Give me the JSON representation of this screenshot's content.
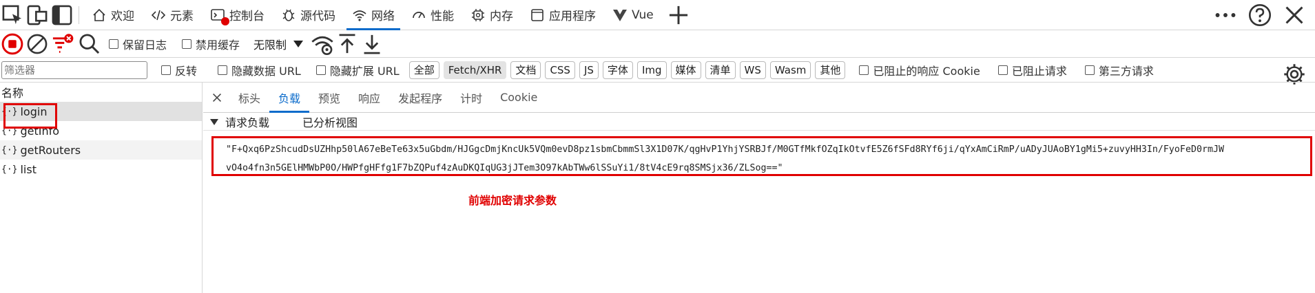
{
  "colors": {
    "accent": "#0b6bcb",
    "highlight": "#e00000",
    "record": "#e00000"
  },
  "tabs": [
    {
      "label": "欢迎",
      "icon": "home-icon"
    },
    {
      "label": "元素",
      "icon": "code-icon"
    },
    {
      "label": "控制台",
      "icon": "console-icon"
    },
    {
      "label": "源代码",
      "icon": "bug-icon"
    },
    {
      "label": "网络",
      "icon": "wifi-icon",
      "active": true
    },
    {
      "label": "性能",
      "icon": "gauge-icon"
    },
    {
      "label": "内存",
      "icon": "memory-chip-icon"
    },
    {
      "label": "应用程序",
      "icon": "application-icon"
    },
    {
      "label": "Vue",
      "icon": "vue-logo-icon"
    }
  ],
  "toolbar": {
    "preserve_log": "保留日志",
    "disable_cache": "禁用缓存",
    "throttle": "无限制"
  },
  "filterbar": {
    "filter_placeholder": "筛选器",
    "invert": "反转",
    "hide_data_url": "隐藏数据 URL",
    "hide_ext_url": "隐藏扩展 URL",
    "types": [
      "全部",
      "Fetch/XHR",
      "文档",
      "CSS",
      "JS",
      "字体",
      "Img",
      "媒体",
      "清单",
      "WS",
      "Wasm",
      "其他"
    ],
    "blocked_cookie": "已阻止的响应 Cookie",
    "blocked_requests": "已阻止请求",
    "third_party": "第三方请求"
  },
  "left": {
    "header": "名称",
    "requests": [
      "login",
      "getInfo",
      "getRouters",
      "list"
    ]
  },
  "detail": {
    "subtabs": [
      "标头",
      "负载",
      "预览",
      "响应",
      "发起程序",
      "计时",
      "Cookie"
    ],
    "section_title": "请求负载",
    "parsed_view": "已分析视图",
    "payload_line1": "\"F+Qxq6PzShcudDsUZHhp50lA67eBeTe63x5uGbdm/HJGgcDmjKncUk5VQm0evD8pz1sbmCbmmSl3X1D07K/qgHvP1YhjYSRBJf/M0GTfMkfOZqIkOtvfE5Z6fSFd8RYf6ji/qYxAmCiRmP/uADyJUAoBY1gMi5+zuvyHH3In/FyoFeD0rmJW",
    "payload_line2": "vO4o4fn3n5GElHMWbP0O/HWPfgHFfg1F7bZQPuf4zAuDKQIqUG3jJTem3O97kAbTWw6lSSuYi1/8tV4cE9rq8SMSjx36/ZLSog==\"",
    "annotation": "前端加密请求参数"
  }
}
